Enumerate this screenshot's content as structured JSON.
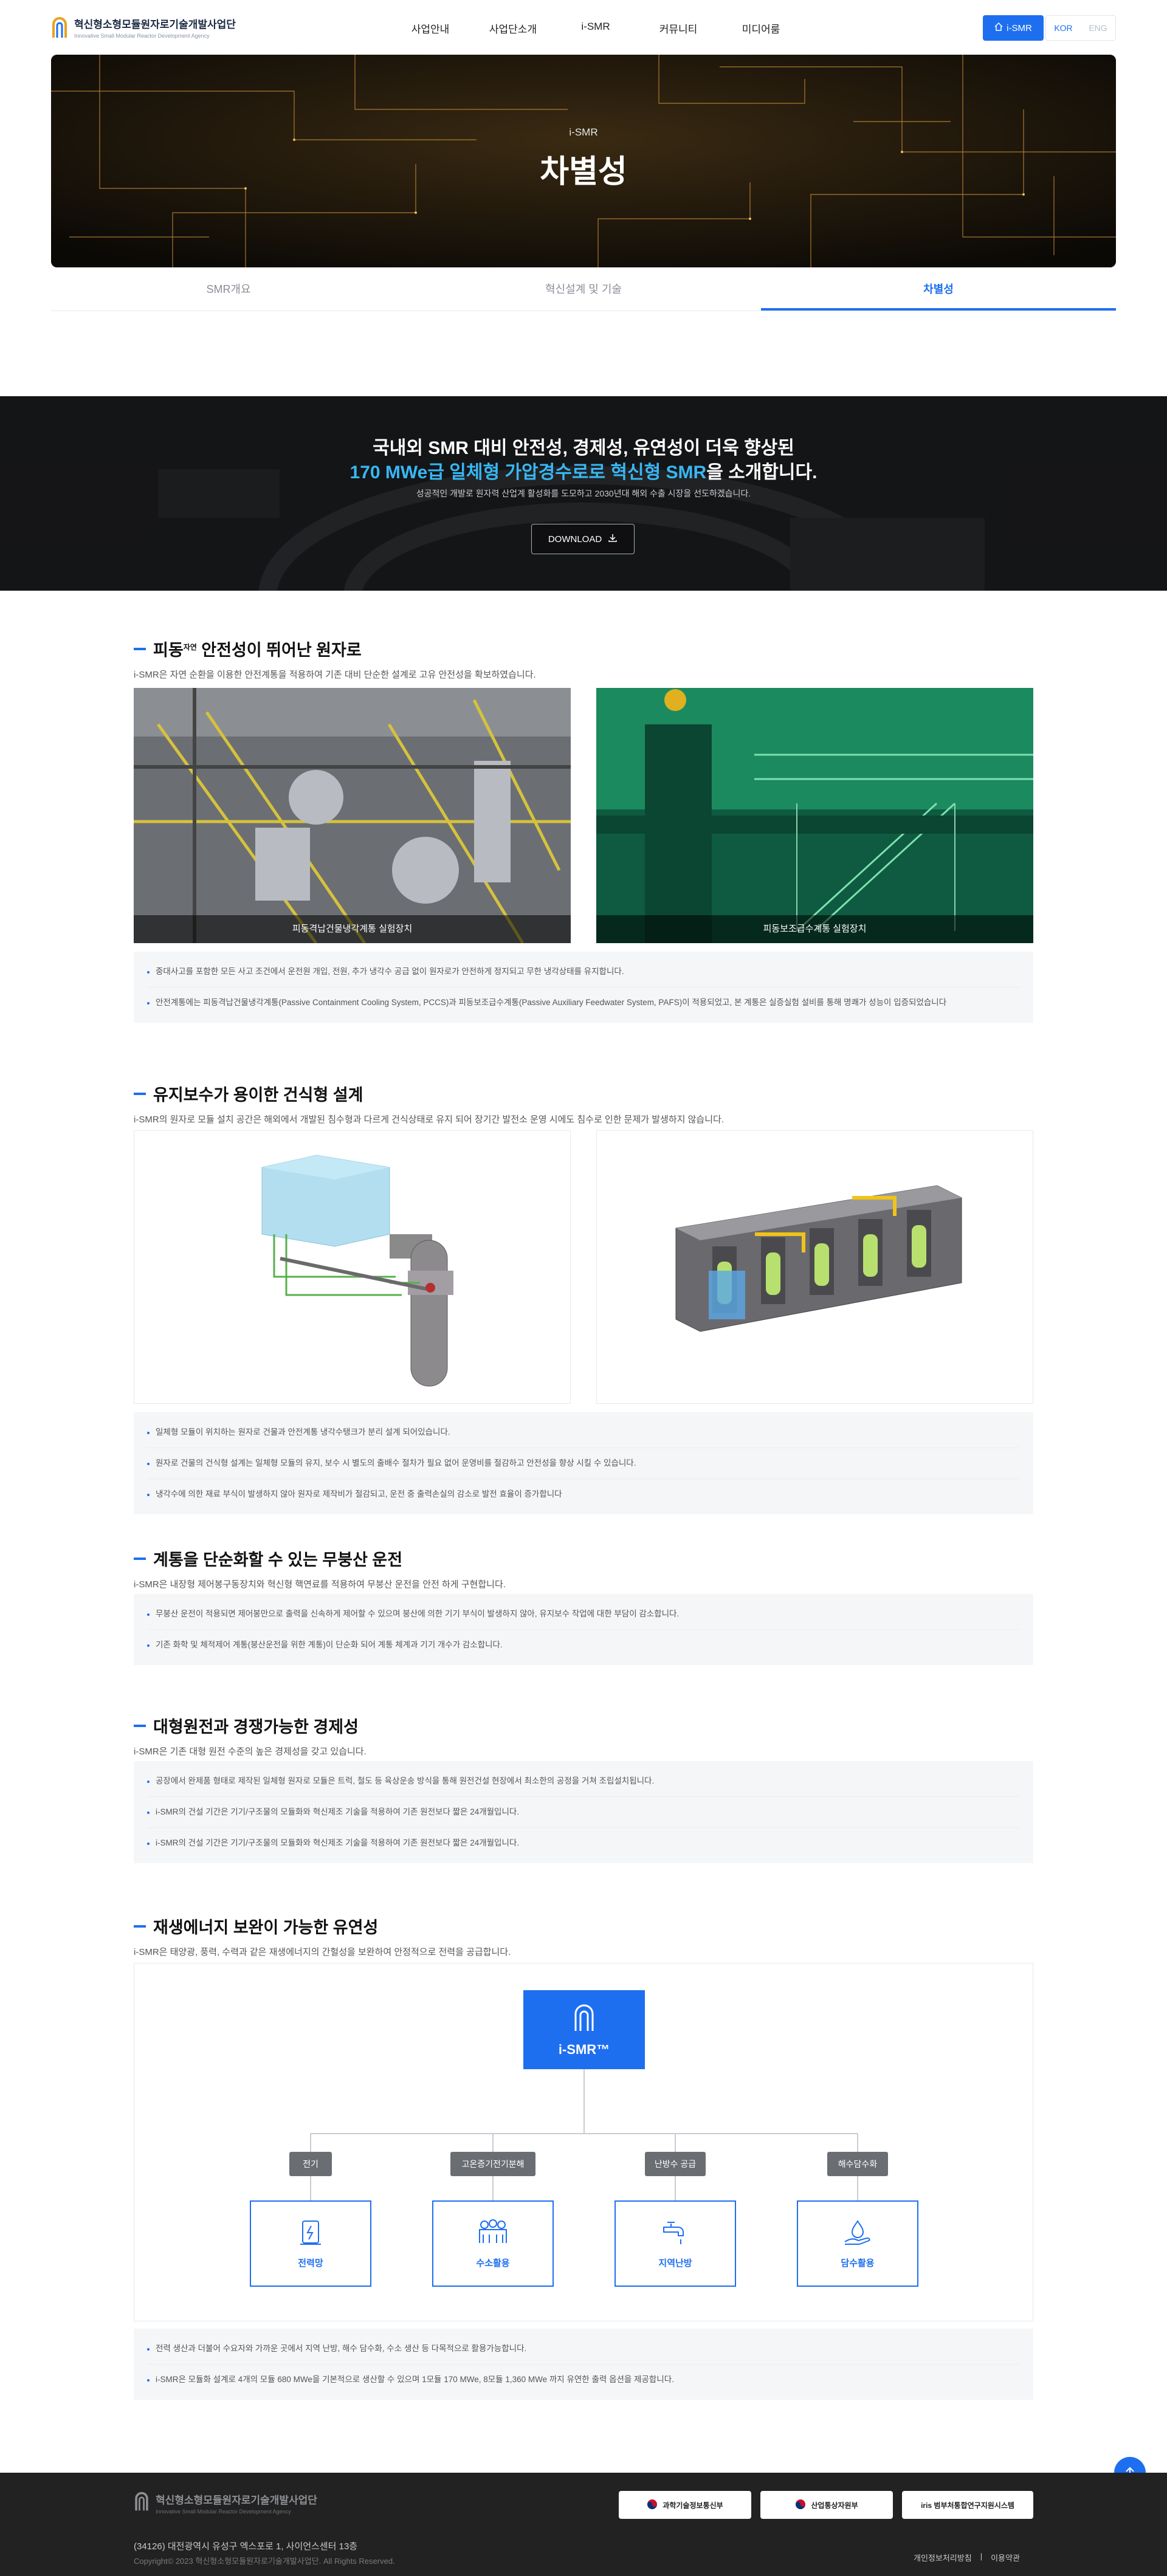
{
  "header": {
    "logo_title": "혁신형소형모듈원자로기술개발사업단",
    "logo_sub": "Innovative Small Modular Reactor Development Agency",
    "nav": [
      "사업안내",
      "사업단소개",
      "i-SMR",
      "커뮤니티",
      "미디어룸"
    ],
    "ismr_button": "i-SMR",
    "lang": {
      "kor": "KOR",
      "eng": "ENG"
    }
  },
  "hero": {
    "subtitle": "i-SMR",
    "title": "차별성"
  },
  "tabs": [
    {
      "label": "SMR개요",
      "active": false
    },
    {
      "label": "혁신설계 및 기술",
      "active": false
    },
    {
      "label": "차별성",
      "active": true
    }
  ],
  "banner": {
    "line1": "국내외 SMR 대비 안전성, 경제성, 유연성이 더욱 향상된",
    "line2_highlight": "170 MWe급 일체형 가압경수로 로 혁신형 SMR",
    "line2_a": "170 MWe급 일체형 가압경수로로 혁신형 SMR",
    "line2_b": "을 소개합니다.",
    "line3": "성공적인 개발로 원자력 산업계 활성화를 도모하고 2030년대 해외 수출 시장을 선도하겠습니다.",
    "download": "DOWNLOAD"
  },
  "sections": {
    "s1": {
      "title": "피동자연 안전성이 뛰어난 원자로",
      "title_main": "피동",
      "title_sup": "자연",
      "title_rest": " 안전성이 뛰어난 원자로",
      "desc": "i-SMR은 자연 순환을 이용한 안전계통을 적용하여 기존 대비 단순한 설계로 고유 안전성을 확보하였습니다.",
      "captions": [
        "피동격납건물냉각계통 실험장치",
        "피동보조급수계통 실험장치"
      ],
      "bullets": [
        "중대사고를 포함한 모든 사고 조건에서 운전원 개입, 전원, 추가 냉각수 공급 없이 원자로가 안전하게 정지되고 무한 냉각상태를 유지합니다.",
        "안전계통에는 피동격납건물냉각계통(Passive Containment Cooling System, PCCS)과 피동보조급수계통(Passive Auxiliary Feedwater System, PAFS)이 적용되었고, 본 계통은 실증실험 설비를 통해 명쾌가 성능이 입증되었습니다"
      ]
    },
    "s2": {
      "title": "유지보수가 용이한 건식형 설계",
      "desc": "i-SMR의 원자로 모듈 설치 공간은 해외에서 개발된 침수형과 다르게 건식상태로 유지 되어 장기간 발전소 운영 시에도 침수로 인한 문제가 발생하지 않습니다.",
      "bullets": [
        "일체형 모듈이 위치하는 원자로 건물과 안전계통 냉각수탱크가 분리 설계 되어있습니다.",
        "원자로 건물의 건식형 설계는 일체형 모듈의 유지, 보수 시 별도의 출배수 절차가 필요 없어 운영비를 절감하고 안전성을 향상 시킬 수 있습니다.",
        "냉각수에 의한 재료 부식이 발생하지 않아 원자로 제작비가 절감되고, 운전 중 출력손실의 감소로 발전 효율이 증가합니다"
      ]
    },
    "s3": {
      "title": "계통을 단순화할 수 있는 무붕산 운전",
      "desc": "i-SMR은 내장형 제어봉구동장치와 혁신형 핵연료를 적용하여 무붕산 운전을 안전 하게 구현합니다.",
      "bullets": [
        "무붕산 운전이 적용되면 제어봉만으로 출력을 신속하게 제어할 수 있으며 붕산에 의한 기기 부식이 발생하지 않아, 유지보수 작업에 대한 부담이 감소합니다.",
        "기존 화학 및 체적제어 계통(붕산운전을 위한 계통)이 단순화 되어 계통 체계과 기기 개수가 감소합니다."
      ]
    },
    "s4": {
      "title": "대형원전과 경쟁가능한 경제성",
      "desc": "i-SMR은 기존 대형 원전 수준의 높은 경제성을 갖고 있습니다.",
      "bullets": [
        "공장에서 완제품 형태로 제작된 일체형 원자로 모듈은 트럭, 철도 등 육상운송 방식을 통해 원전건설 현장에서 최소한의 공정을 거쳐 조립설치됩니다.",
        "i-SMR의 건설 기간은 기기/구조물의 모듈화와 혁신제조 기술을 적용하여 기존 원전보다 짧은 24개월입니다.",
        "i-SMR의 건설 기간은 기기/구조물의 모듈화와 혁신제조 기술을 적용하여 기존 원전보다 짧은 24개월입니다."
      ]
    },
    "s5": {
      "title": "재생에너지 보완이 가능한 유연성",
      "desc": "i-SMR은 태양광, 풍력, 수력과 같은 재생에너지의 간헐성을 보완하여 안정적으로 전력을 공급합니다.",
      "center": "i-SMR™",
      "tags": [
        "전기",
        "고온증기전기분해",
        "난방수 공급",
        "해수담수화"
      ],
      "cards": [
        "전력망",
        "수소활용",
        "지역난방",
        "담수활용"
      ],
      "bullets": [
        "전력 생산과 더불어 수요자와 가까운 곳에서 지역 난방, 해수 담수화, 수소 생산 등 다목적으로 활용가능합니다.",
        "i-SMR은 모듈화 설계로 4개의 모듈 680 MWe을 기본적으로 생산할 수 있으며 1모듈 170 MWe, 8모듈 1,360 MWe 까지 유연한 출력 옵션을 제공합니다."
      ]
    }
  },
  "footer": {
    "logo_title": "혁신형소형모듈원자로기술개발사업단",
    "logo_sub": "Innovative Small Modular Reactor Development Agency",
    "address": "(34126) 대전광역시 유성구 엑스포로 1, 사이언스센터 13층",
    "copyright": "Copyright© 2023 혁신형소형모듈원자로기술개발사업단. All Rights Reserved.",
    "links": [
      "개인정보처리방침",
      "|",
      "이용약관"
    ],
    "badges": [
      "과학기술정보통신부",
      "산업통상자원부",
      "iris 범부처통합연구지원시스템"
    ]
  },
  "colors": {
    "accent": "#1e6ff0",
    "highlight": "#38b7f4",
    "footer_bg": "#222222"
  }
}
